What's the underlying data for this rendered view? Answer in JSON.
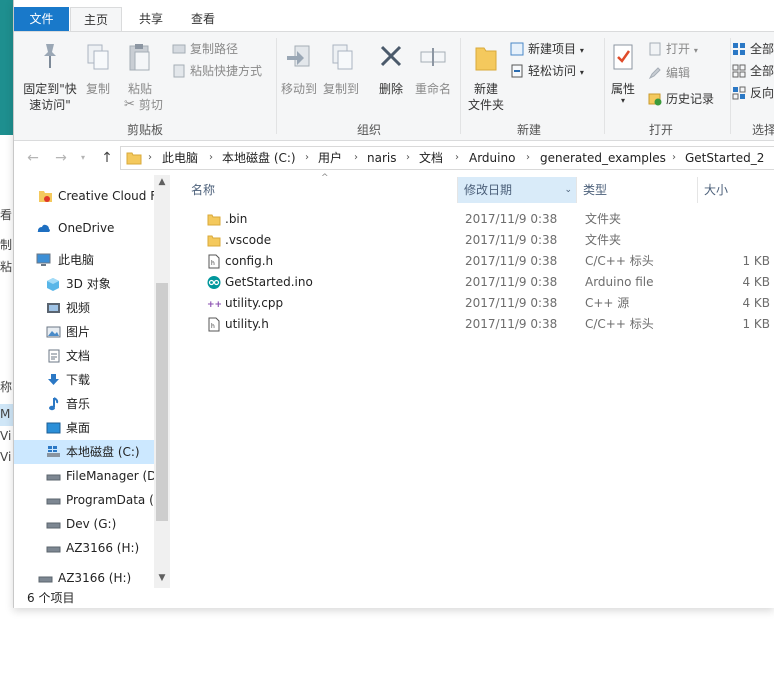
{
  "background": {
    "fragments": [
      "看",
      "制",
      "粘",
      "称",
      "M",
      "Vi",
      "Vi"
    ]
  },
  "tabs": {
    "file": "文件",
    "home": "主页",
    "share": "共享",
    "view": "查看"
  },
  "ribbon": {
    "clipboard": {
      "pin": "固定到\"快速访问\"",
      "copy": "复制",
      "paste": "粘贴",
      "copy_path": "复制路径",
      "paste_shortcut": "粘贴快捷方式",
      "cut": "剪切",
      "label": "剪贴板"
    },
    "organize": {
      "move_to": "移动到",
      "copy_to": "复制到",
      "delete": "删除",
      "rename": "重命名",
      "label": "组织"
    },
    "new": {
      "new_folder": "新建\n文件夹",
      "new_item": "新建项目",
      "easy_access": "轻松访问",
      "label": "新建"
    },
    "open": {
      "properties": "属性",
      "open": "打开",
      "edit": "编辑",
      "history": "历史记录",
      "label": "打开"
    },
    "select": {
      "select_all": "全部",
      "select_none": "全部",
      "invert": "反向",
      "label": "选择"
    }
  },
  "address": {
    "crumbs": [
      "此电脑",
      "本地磁盘 (C:)",
      "用户",
      "naris",
      "文档",
      "Arduino",
      "generated_examples",
      "GetStarted_2"
    ]
  },
  "nav": {
    "items": [
      {
        "label": "Creative Cloud F",
        "icon": "creative-cloud-icon"
      },
      {
        "label": "OneDrive",
        "icon": "onedrive-icon"
      },
      {
        "label": "此电脑",
        "icon": "this-pc-icon"
      },
      {
        "label": "3D 对象",
        "icon": "3d-objects-icon"
      },
      {
        "label": "视频",
        "icon": "videos-icon"
      },
      {
        "label": "图片",
        "icon": "pictures-icon"
      },
      {
        "label": "文档",
        "icon": "documents-icon"
      },
      {
        "label": "下载",
        "icon": "downloads-icon"
      },
      {
        "label": "音乐",
        "icon": "music-icon"
      },
      {
        "label": "桌面",
        "icon": "desktop-icon"
      },
      {
        "label": "本地磁盘 (C:)",
        "icon": "windows-drive-icon"
      },
      {
        "label": "FileManager (D",
        "icon": "drive-icon"
      },
      {
        "label": "ProgramData (",
        "icon": "drive-icon"
      },
      {
        "label": "Dev (G:)",
        "icon": "drive-icon"
      },
      {
        "label": "AZ3166 (H:)",
        "icon": "drive-icon"
      },
      {
        "label": "AZ3166 (H:)",
        "icon": "drive-icon"
      }
    ]
  },
  "columns": {
    "name": "名称",
    "date": "修改日期",
    "type": "类型",
    "size": "大小"
  },
  "files": [
    {
      "name": ".bin",
      "date": "2017/11/9 0:38",
      "type": "文件夹",
      "size": "",
      "icon": "folder-icon"
    },
    {
      "name": ".vscode",
      "date": "2017/11/9 0:38",
      "type": "文件夹",
      "size": "",
      "icon": "folder-icon"
    },
    {
      "name": "config.h",
      "date": "2017/11/9 0:38",
      "type": "C/C++ 标头",
      "size": "1 KB",
      "icon": "header-file-icon"
    },
    {
      "name": "GetStarted.ino",
      "date": "2017/11/9 0:38",
      "type": "Arduino file",
      "size": "4 KB",
      "icon": "arduino-file-icon"
    },
    {
      "name": "utility.cpp",
      "date": "2017/11/9 0:38",
      "type": "C++ 源",
      "size": "4 KB",
      "icon": "cpp-file-icon"
    },
    {
      "name": "utility.h",
      "date": "2017/11/9 0:38",
      "type": "C/C++ 标头",
      "size": "1 KB",
      "icon": "header-file-icon"
    }
  ],
  "status": {
    "count": "6 个项目"
  },
  "colors": {
    "file_tab": "#1979ca",
    "selection": "#cce8ff",
    "folder": "#f4c95d"
  }
}
